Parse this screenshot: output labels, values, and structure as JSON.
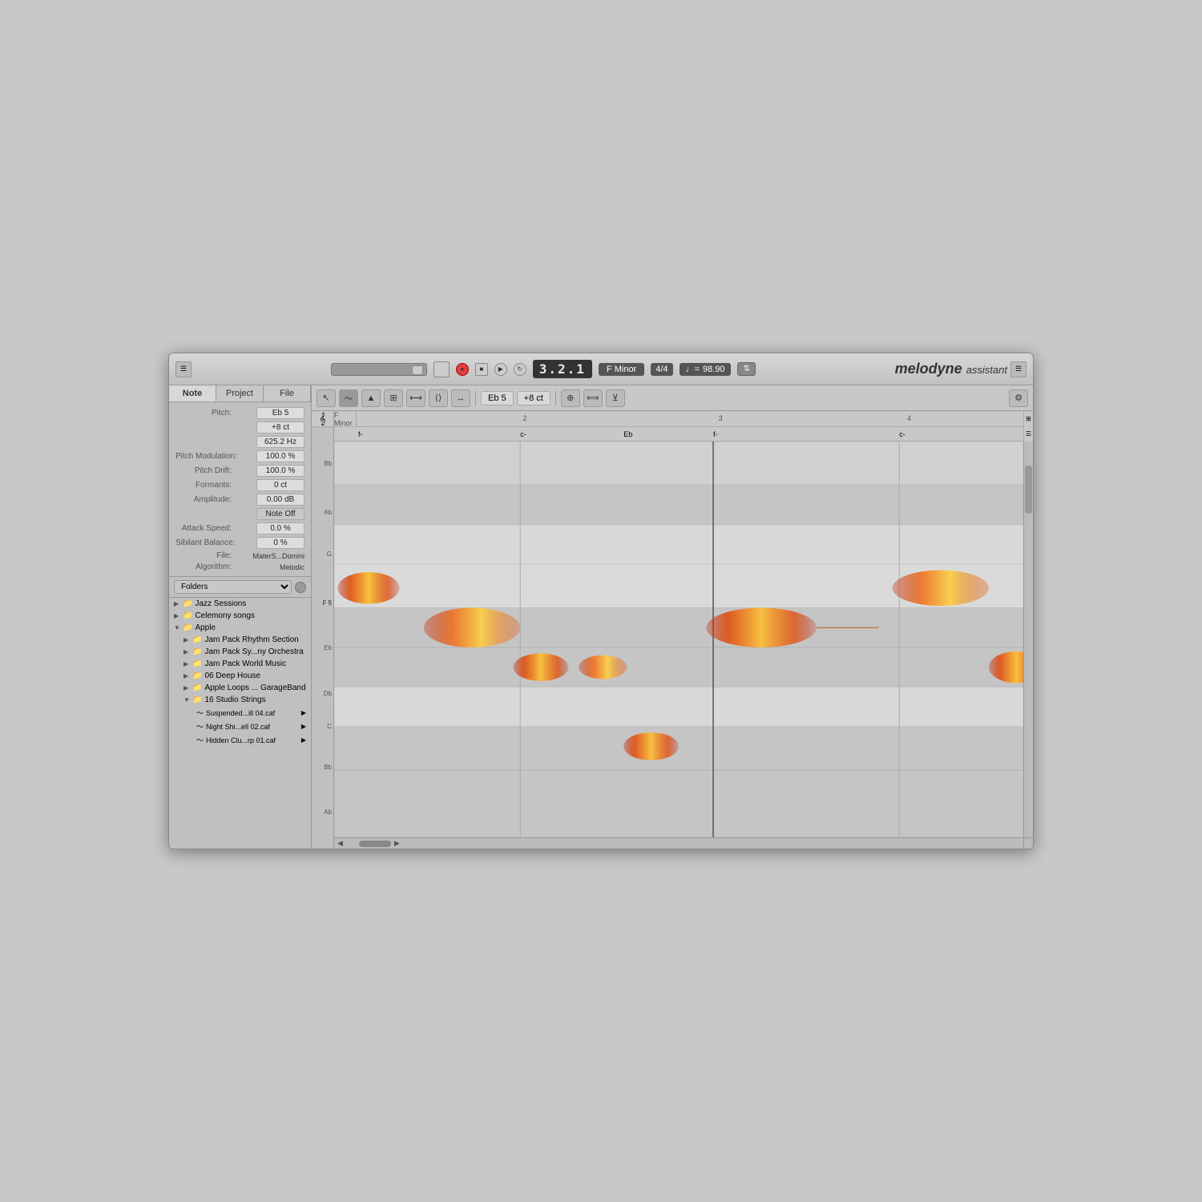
{
  "window": {
    "title": "Melodyne Assistant"
  },
  "titlebar": {
    "transport": {
      "slider_label": "position",
      "record_label": "●",
      "stop_label": "■",
      "play_label": "▶",
      "loop_label": "↻",
      "timecode": "3.2.1",
      "key": "F Minor",
      "time_sig": "4/4",
      "tempo_icon": "♩",
      "tempo": "98.90",
      "pitch_btn": "⇅"
    },
    "logo": "melodyne",
    "logo_sub": "assistant"
  },
  "left_panel": {
    "tabs": [
      "Note",
      "Project",
      "File"
    ],
    "active_tab": "Note",
    "properties": {
      "pitch_label": "Pitch:",
      "pitch_value": "Eb 5",
      "pitch_cents": "+8 ct",
      "pitch_hz": "625.2 Hz",
      "pitch_mod_label": "Pitch Modulation:",
      "pitch_mod_value": "100.0 %",
      "pitch_drift_label": "Pitch Drift:",
      "pitch_drift_value": "100.0 %",
      "formants_label": "Formants:",
      "formants_value": "0 ct",
      "amplitude_label": "Amplitude:",
      "amplitude_value": "0.00 dB",
      "note_off_label": "Note Off",
      "attack_label": "Attack Speed:",
      "attack_value": "0.0 %",
      "sibilant_label": "Sibilant Balance:",
      "sibilant_value": "0 %",
      "file_label": "File:",
      "file_value": "MaterS...Domini",
      "algo_label": "Algorithm:",
      "algo_value": "Melodic"
    },
    "library": {
      "folders_label": "Folders",
      "items": [
        {
          "label": "Jazz Sessions",
          "level": 0,
          "expanded": false,
          "type": "folder"
        },
        {
          "label": "Celemony songs",
          "level": 0,
          "expanded": false,
          "type": "folder"
        },
        {
          "label": "Apple",
          "level": 0,
          "expanded": true,
          "type": "folder"
        },
        {
          "label": "Jam Pack Rhythm Section",
          "level": 1,
          "expanded": false,
          "type": "folder"
        },
        {
          "label": "Jam Pack Sy...ny Orchestra",
          "level": 1,
          "expanded": false,
          "type": "folder"
        },
        {
          "label": "Jam Pack World Music",
          "level": 1,
          "expanded": false,
          "type": "folder"
        },
        {
          "label": "06 Deep House",
          "level": 1,
          "expanded": false,
          "type": "folder"
        },
        {
          "label": "Apple Loops ... GarageBand",
          "level": 1,
          "expanded": false,
          "type": "folder"
        },
        {
          "label": "16 Studio Strings",
          "level": 1,
          "expanded": true,
          "type": "folder"
        },
        {
          "label": "Suspended...ill 04.caf",
          "level": 2,
          "expanded": false,
          "type": "file"
        },
        {
          "label": "Night Shi...ell 02.caf",
          "level": 2,
          "expanded": false,
          "type": "file"
        },
        {
          "label": "Hidden Clu...rp 01.caf",
          "level": 2,
          "expanded": false,
          "type": "file"
        }
      ]
    }
  },
  "editor": {
    "toolbar": {
      "tools": [
        "✎",
        "⬚",
        "↕",
        "⟺",
        "⟷",
        "⊞",
        "⟨⟩",
        "↔"
      ],
      "pitch_display": "Eb 5",
      "cent_display": "+8 ct",
      "tools2": [
        "⊕",
        "⟺",
        "⊻"
      ]
    },
    "grid": {
      "key_label": "F Minor",
      "markers": [
        "2",
        "3",
        "4"
      ],
      "chord_labels": [
        "f-",
        "c-",
        "Eb",
        "f-",
        "c-"
      ],
      "note_labels": [
        "Bb",
        "Ab",
        "G",
        "F 5",
        "Eb",
        "Db",
        "C",
        "Bb",
        "Ab"
      ],
      "row_labels": [
        "Bb",
        "Ab",
        "G",
        "F5",
        "Eb",
        "Db",
        "C",
        "Bb",
        "Ab"
      ]
    }
  },
  "colors": {
    "accent": "#e05010",
    "blob_hot": "#e06010",
    "blob_warm": "#f0a020",
    "blob_yellow": "#f8d050",
    "background": "#b0b0b0",
    "panel": "#c0c0c0",
    "selected_blue": "#6699cc"
  }
}
